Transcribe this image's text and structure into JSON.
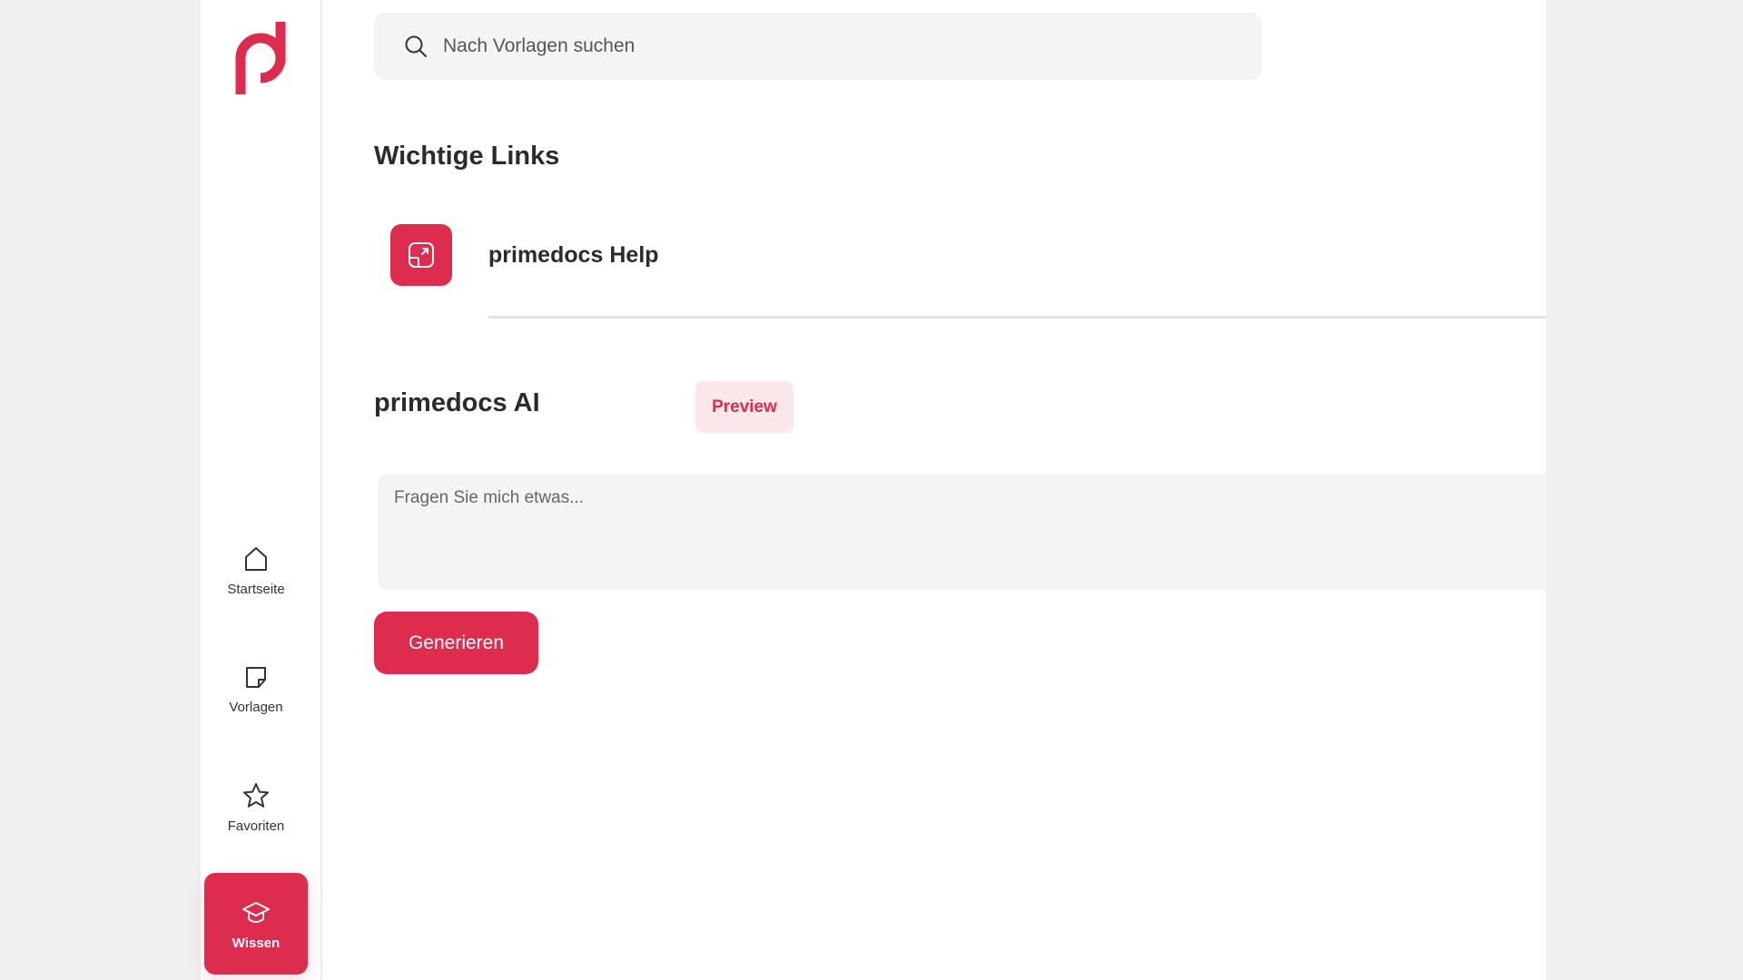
{
  "brand": {
    "logo_icon": "primedocs-p-logo",
    "accent_color": "#dd2c4e"
  },
  "sidebar": {
    "items": [
      {
        "label": "Startseite",
        "icon": "home-icon",
        "active": false
      },
      {
        "label": "Vorlagen",
        "icon": "sticky-note-icon",
        "active": false
      },
      {
        "label": "Favoriten",
        "icon": "star-icon",
        "active": false
      },
      {
        "label": "Wissen",
        "icon": "graduation-cap-icon",
        "active": true
      }
    ]
  },
  "search": {
    "placeholder": "Nach Vorlagen suchen",
    "value": "",
    "icon": "search-icon"
  },
  "links_section": {
    "title": "Wichtige Links",
    "items": [
      {
        "label": "primedocs Help",
        "icon": "external-link-icon"
      }
    ]
  },
  "ai_section": {
    "title": "primedocs AI",
    "badge": "Preview",
    "prompt_placeholder": "Fragen Sie mich etwas...",
    "prompt_value": "",
    "generate_label": "Generieren"
  }
}
